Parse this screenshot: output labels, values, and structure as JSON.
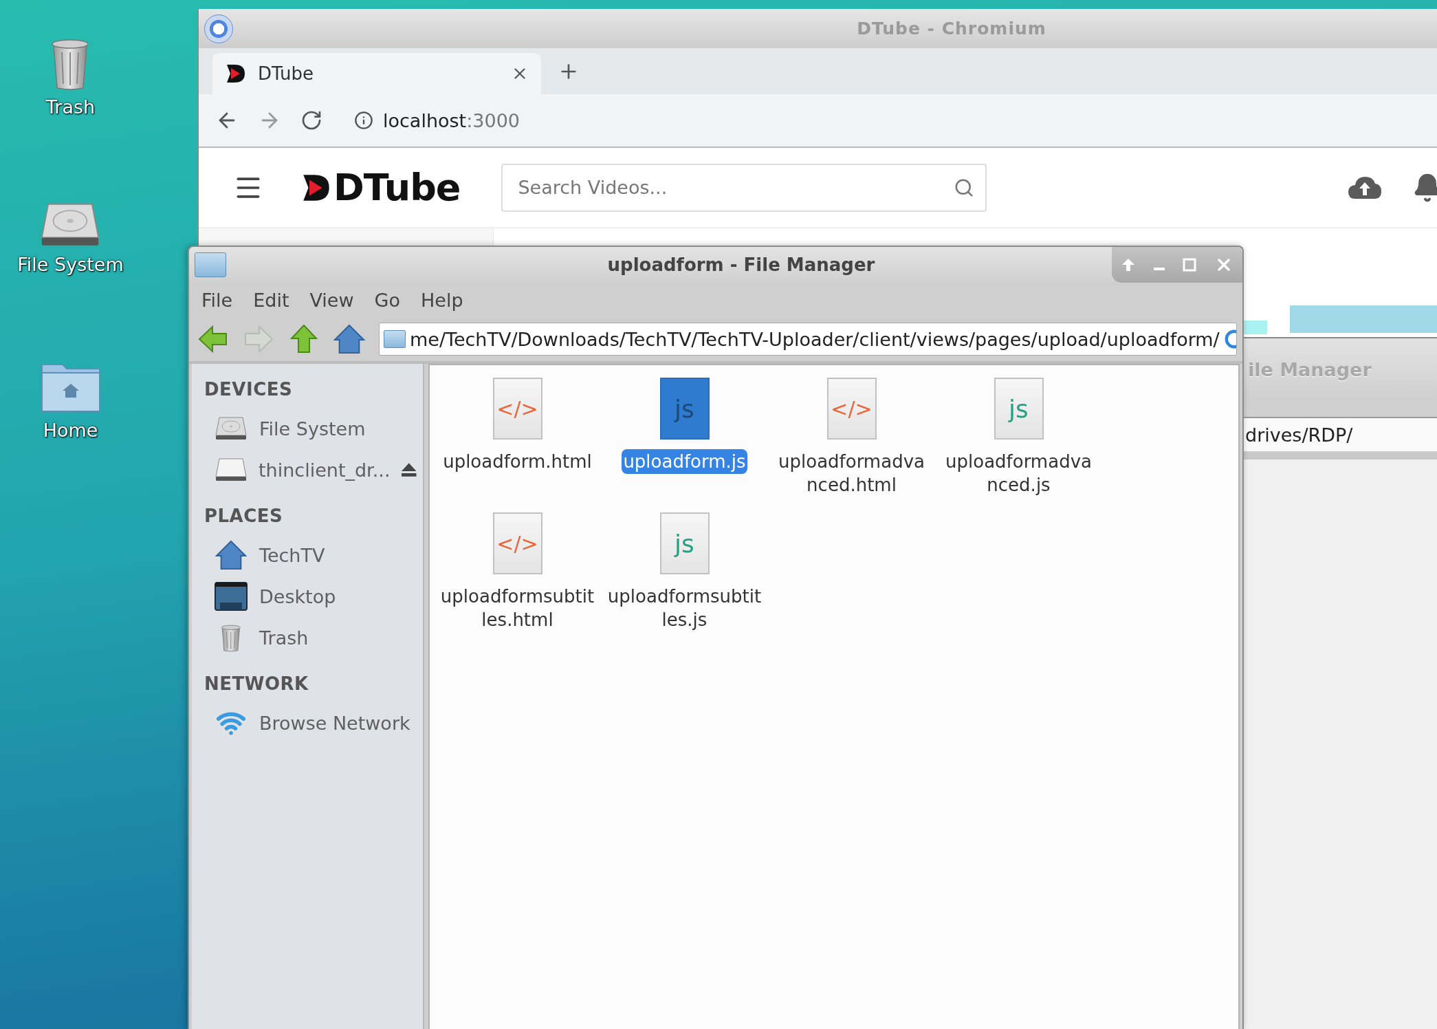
{
  "desktop_icons": [
    {
      "label": "Trash",
      "kind": "trash"
    },
    {
      "label": "File System",
      "kind": "drive"
    },
    {
      "label": "Home",
      "kind": "home"
    }
  ],
  "browser": {
    "title": "DTube - Chromium",
    "tabs": [
      {
        "label": "DTube",
        "selected": true
      }
    ],
    "url": {
      "host": "localhost",
      "port": ":3000"
    },
    "page": {
      "logo": "DTube",
      "search": {
        "placeholder": "Search Videos..."
      }
    }
  },
  "background_window": {
    "title": "ile Manager",
    "path": "drives/RDP/"
  },
  "file_manager": {
    "title": "uploadform - File Manager",
    "menu": [
      "File",
      "Edit",
      "View",
      "Go",
      "Help"
    ],
    "path": "me/TechTV/Downloads/TechTV/TechTV-Uploader/client/views/pages/upload/uploadform/",
    "sidebar": [
      {
        "heading": "DEVICES",
        "items": [
          {
            "label": "File System",
            "kind": "drive",
            "eject": false
          },
          {
            "label": "thinclient_dr...",
            "kind": "removable",
            "eject": true
          }
        ]
      },
      {
        "heading": "PLACES",
        "items": [
          {
            "label": "TechTV",
            "kind": "home",
            "eject": false
          },
          {
            "label": "Desktop",
            "kind": "desktop",
            "eject": false
          },
          {
            "label": "Trash",
            "kind": "trash",
            "eject": false
          }
        ]
      },
      {
        "heading": "NETWORK",
        "items": [
          {
            "label": "Browse Network",
            "kind": "network",
            "eject": false
          }
        ]
      }
    ],
    "files": [
      {
        "name": "uploadform.html",
        "kind": "html",
        "glyph": "</>",
        "selected": false
      },
      {
        "name": "uploadform.js",
        "kind": "js",
        "glyph": "js",
        "selected": true
      },
      {
        "name": "uploadformadvanced.html",
        "kind": "html",
        "glyph": "</>",
        "selected": false
      },
      {
        "name": "uploadformadvanced.js",
        "kind": "js",
        "glyph": "js",
        "selected": false
      },
      {
        "name": "uploadformsubtitles.html",
        "kind": "html",
        "glyph": "</>",
        "selected": false
      },
      {
        "name": "uploadformsubtitles.js",
        "kind": "js",
        "glyph": "js",
        "selected": false
      }
    ]
  }
}
